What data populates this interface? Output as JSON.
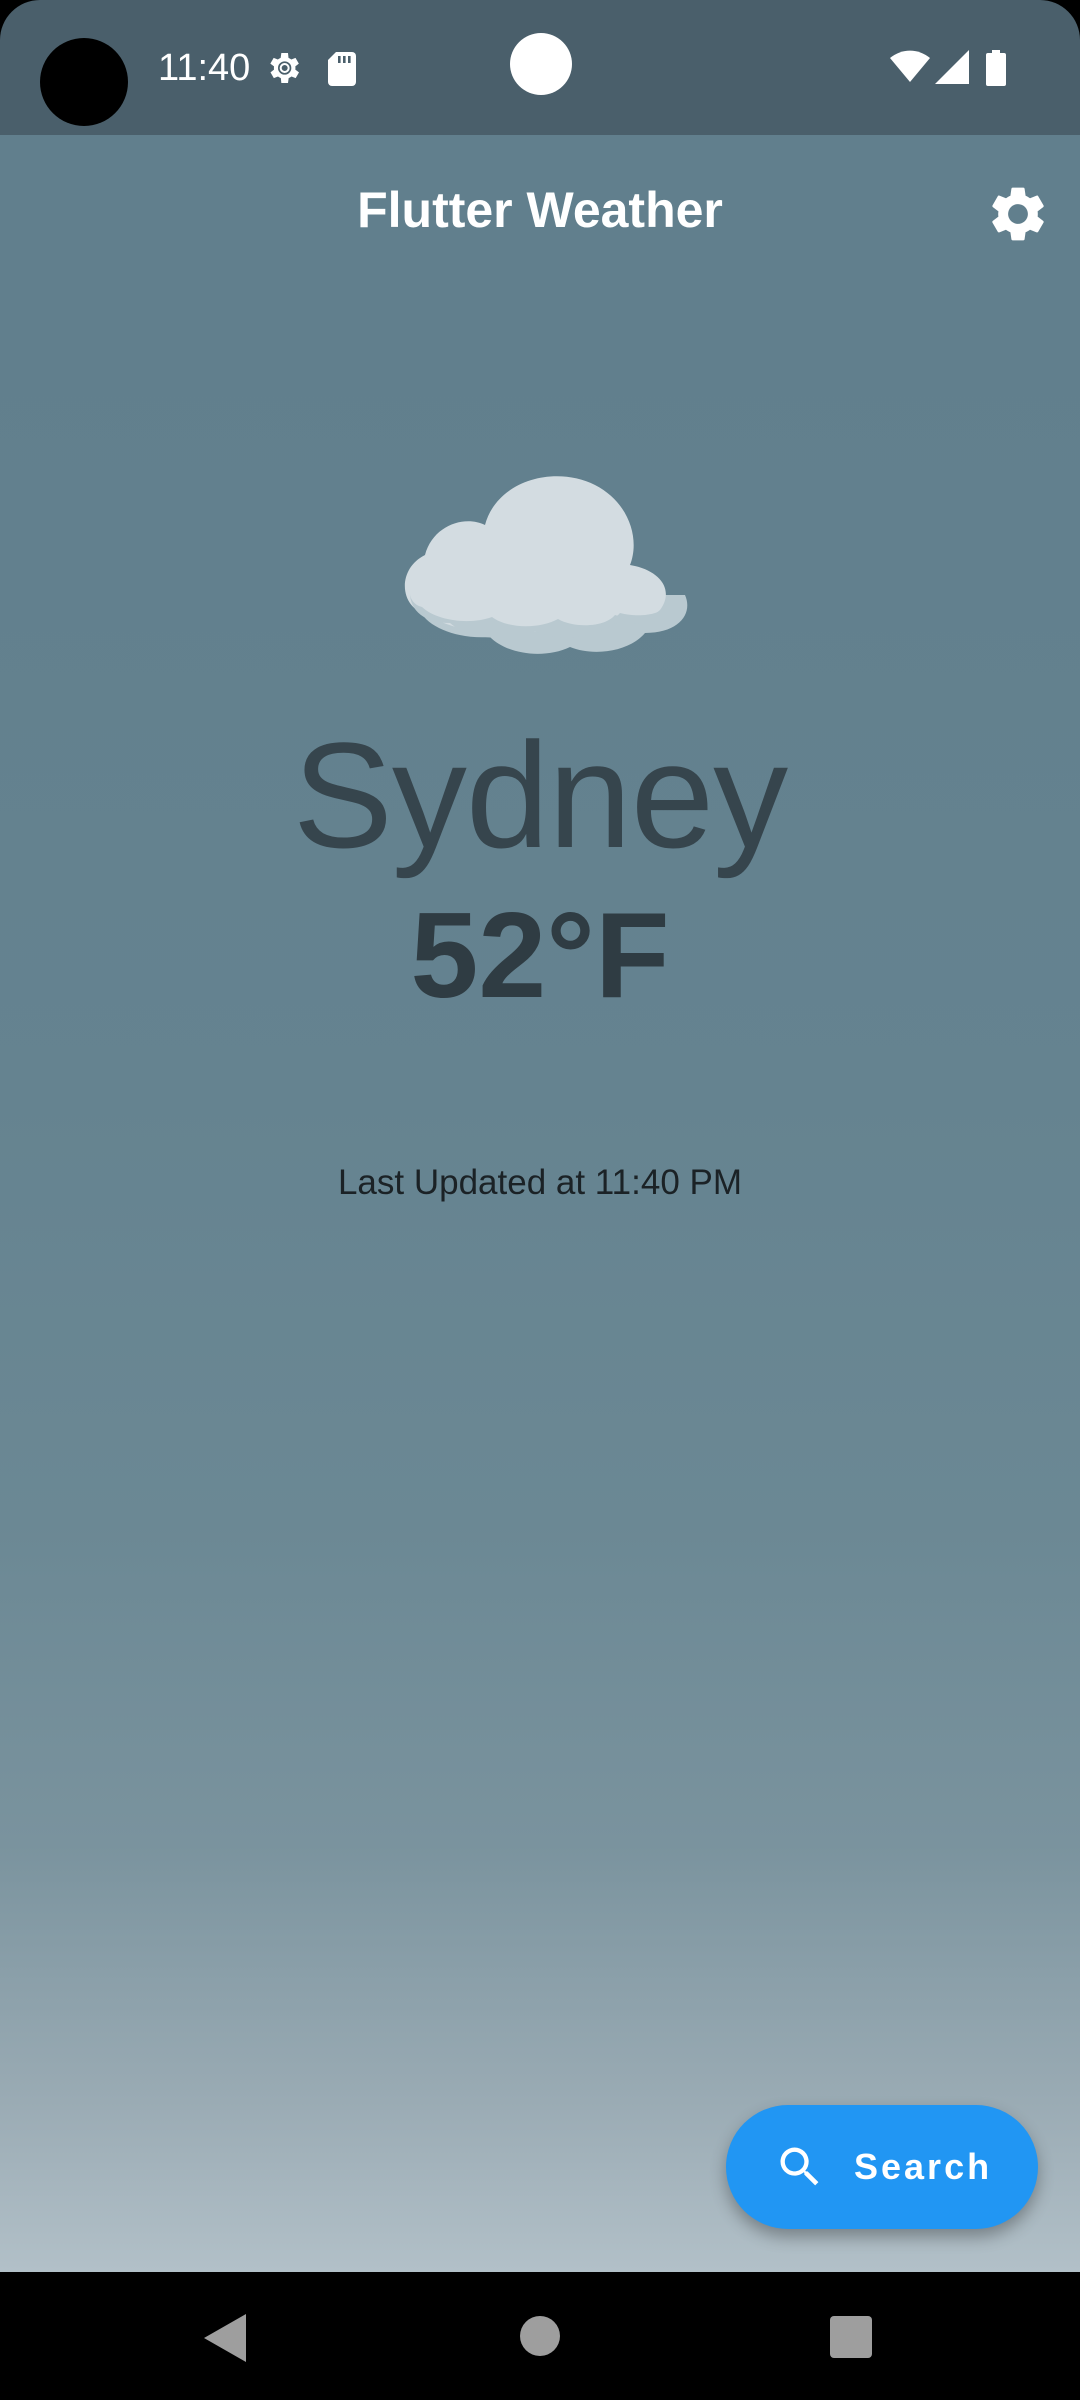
{
  "status_bar": {
    "time": "11:40",
    "icons": [
      "settings-gear-icon",
      "sd-card-icon",
      "wifi-icon",
      "cell-signal-icon",
      "battery-icon"
    ]
  },
  "app_bar": {
    "title": "Flutter Weather",
    "settings_icon": "gear-icon"
  },
  "weather": {
    "condition_icon": "cloud-icon",
    "city": "Sydney",
    "temperature": "52°F",
    "last_updated": "Last Updated at 11:40 PM"
  },
  "search_button": {
    "label": "Search",
    "icon": "search-icon",
    "color": "#2196f3"
  },
  "colors": {
    "status_bar_bg": "#4a5f6b",
    "background_top": "#617f8d",
    "background_bottom": "#b2c0c8",
    "accent": "#2196f3"
  },
  "nav_bar": {
    "icons": [
      "back-icon",
      "home-icon",
      "recents-icon"
    ]
  }
}
